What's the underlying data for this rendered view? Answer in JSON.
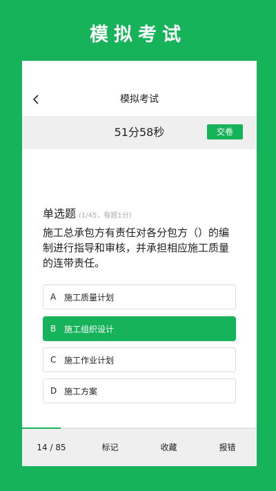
{
  "promo": {
    "title": "模拟考试"
  },
  "nav": {
    "back_icon": "chevron-left-icon",
    "title": "模拟考试"
  },
  "timer": {
    "remaining": "51分58秒",
    "submit_label": "交卷"
  },
  "question": {
    "type_label": "单选题",
    "meta": "(1/45，每题1分)",
    "text": "施工总承包方有责任对各分包方（）的编制进行指导和审核，并承担相应施工质量的连带责任。"
  },
  "options": [
    {
      "letter": "A",
      "text": "施工质量计划",
      "selected": false
    },
    {
      "letter": "B",
      "text": "施工组织设计",
      "selected": true
    },
    {
      "letter": "C",
      "text": "施工作业计划",
      "selected": false
    },
    {
      "letter": "D",
      "text": "施工方案",
      "selected": false
    }
  ],
  "progress": {
    "current": 14,
    "total": 85,
    "label": "14 / 85"
  },
  "bottom_bar": {
    "mark_label": "标记",
    "favorite_label": "收藏",
    "report_label": "报错"
  },
  "colors": {
    "accent": "#16b35a",
    "bar_bg": "#efefef"
  }
}
